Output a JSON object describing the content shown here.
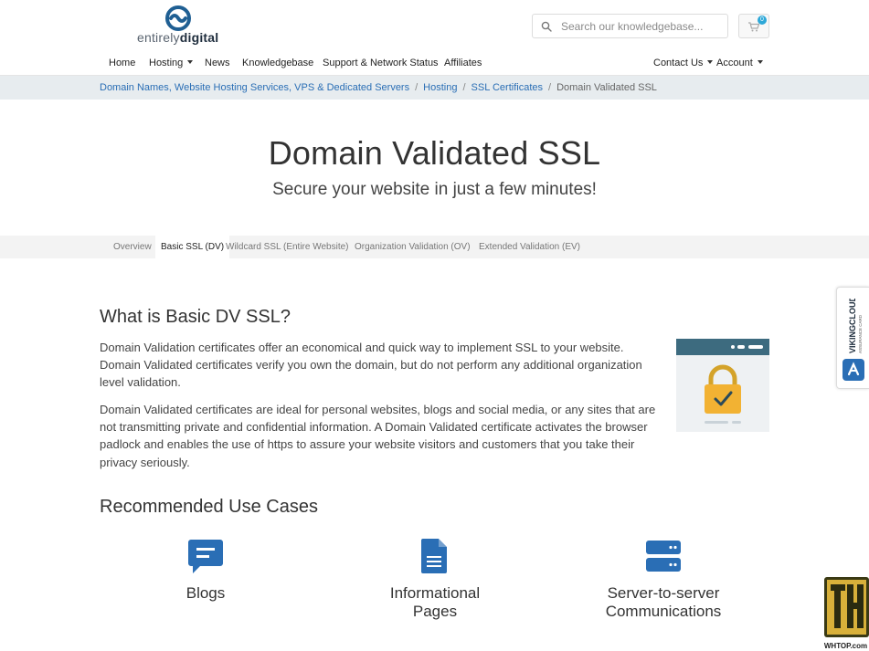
{
  "brand": {
    "light": "entirely",
    "bold": "digital"
  },
  "search": {
    "placeholder": "Search our knowledgebase..."
  },
  "cart": {
    "count": "0"
  },
  "nav": {
    "home": "Home",
    "hosting": "Hosting",
    "news": "News",
    "knowledgebase": "Knowledgebase",
    "support": "Support & Network Status",
    "affiliates": "Affiliates",
    "contact": "Contact Us",
    "account": "Account"
  },
  "breadcrumb": {
    "items": [
      "Domain Names, Website Hosting Services, VPS & Dedicated Servers",
      "Hosting",
      "SSL Certificates"
    ],
    "current": "Domain Validated SSL"
  },
  "hero": {
    "title": "Domain Validated SSL",
    "subtitle": "Secure your website in just a few minutes!"
  },
  "tabs": [
    "Overview",
    "Basic SSL (DV)",
    "Wildcard SSL (Entire Website)",
    "Organization Validation (OV)",
    "Extended Validation (EV)"
  ],
  "active_tab": "Basic SSL (DV)",
  "what": {
    "title": "What is Basic DV SSL?",
    "p1": "Domain Validation certificates offer an economical and quick way to implement SSL to your website. Domain Validated certificates verify you own the domain, but do not perform any additional organization level validation.",
    "p2": "Domain Validated certificates are ideal for personal websites, blogs and social media, or any sites that are not transmitting private and confidential information. A Domain Validated certificate activates the browser padlock and enables the use of https to assure your website visitors and customers that you take their privacy seriously."
  },
  "use_cases": {
    "title": "Recommended Use Cases",
    "items": [
      {
        "icon": "chat-icon",
        "label": "Blogs"
      },
      {
        "icon": "document-icon",
        "label": "Informational Pages"
      },
      {
        "icon": "server-icon",
        "label": "Server-to-server Communications"
      }
    ]
  },
  "badge": {
    "brand": "VIKINGCLOUD",
    "sub": "ASSURANCE CARD"
  },
  "watermark": "WHTOP.com",
  "colors": {
    "accent": "#2a6eb5",
    "breadcrumb_bg": "#e7ecef",
    "icon_blue": "#2a6eb5",
    "logo": "#1f6aa5"
  }
}
